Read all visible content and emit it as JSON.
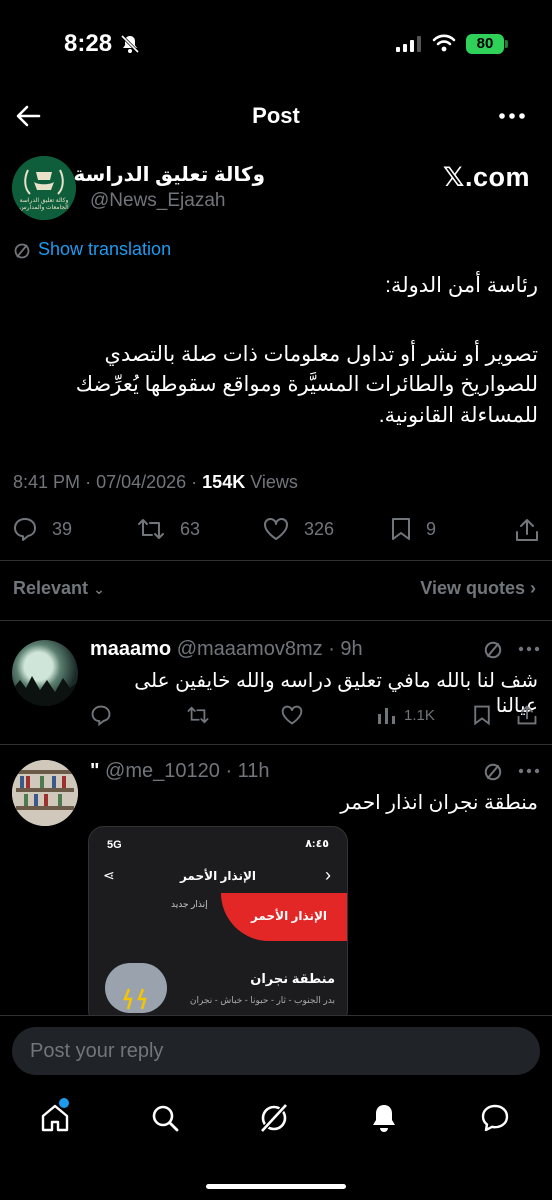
{
  "status_bar": {
    "time": "8:28",
    "battery": "80"
  },
  "header": {
    "title": "Post"
  },
  "post": {
    "author_name": "وكالة تعليق الدراسة",
    "author_handle": "@News_Ejazah",
    "source_badge": "𝕏.com",
    "avatar_text_1": "وكالة تعليق الدراسة",
    "avatar_text_2": "الجامعات والمدارس",
    "show_translation": "Show translation",
    "text_line_1": "رئاسة أمن الدولة:",
    "text_line_2": "تصوير أو نشر أو تداول معلومات ذات صلة بالتصدي",
    "text_line_3": "للصواريخ والطائرات المسيَّرة ومواقع سقوطها يُعرِّضك",
    "text_line_4": "للمساءلة القانونية.",
    "time": "8:41 PM",
    "date": "07/04/2026",
    "views_count": "154K",
    "views_label": "Views",
    "replies": "39",
    "reposts": "63",
    "likes": "326",
    "bookmarks": "9"
  },
  "sort": {
    "relevant_label": "Relevant",
    "view_quotes_label": "View quotes"
  },
  "replies": [
    {
      "name": "maaamo",
      "handle": "@maaamov8mz",
      "age": "9h",
      "text": "شف لنا بالله مافي تعليق دراسه والله خايفين على عيالنا",
      "views": "1.1K"
    },
    {
      "name": "\"",
      "handle": "@me_10120",
      "age": "11h",
      "text": "منطقة نجران انذار احمر",
      "image": {
        "network": "5G",
        "clock": "٨:٤٥",
        "title": "الإنذار الأحمر",
        "red_label": "الإنذار الأحمر",
        "new_alert": "إنذار جديد",
        "region": "منطقة نجران",
        "cities": "بدر الجنوب - ثار - حبونا - خباش - نجران"
      }
    }
  ],
  "reply_bar": {
    "placeholder": "Post your reply"
  },
  "colors": {
    "accent": "#1d9bf0",
    "background": "#000000",
    "muted": "#71767b",
    "alert_red": "#e32626"
  }
}
